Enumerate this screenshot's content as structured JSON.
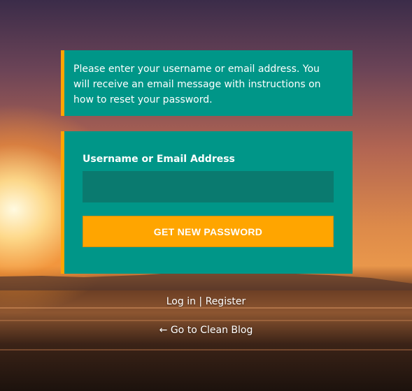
{
  "message": {
    "text": "Please enter your username or email address. You will receive an email message with instructions on how to reset your password."
  },
  "form": {
    "username_label": "Username or Email Address",
    "username_value": "",
    "submit_label": "GET NEW PASSWORD"
  },
  "nav": {
    "login_label": "Log in",
    "separator": " | ",
    "register_label": "Register"
  },
  "back": {
    "label": "← Go to Clean Blog"
  },
  "colors": {
    "panel": "#009688",
    "accent": "#ffa500",
    "input_bg": "#0a7a6f"
  }
}
